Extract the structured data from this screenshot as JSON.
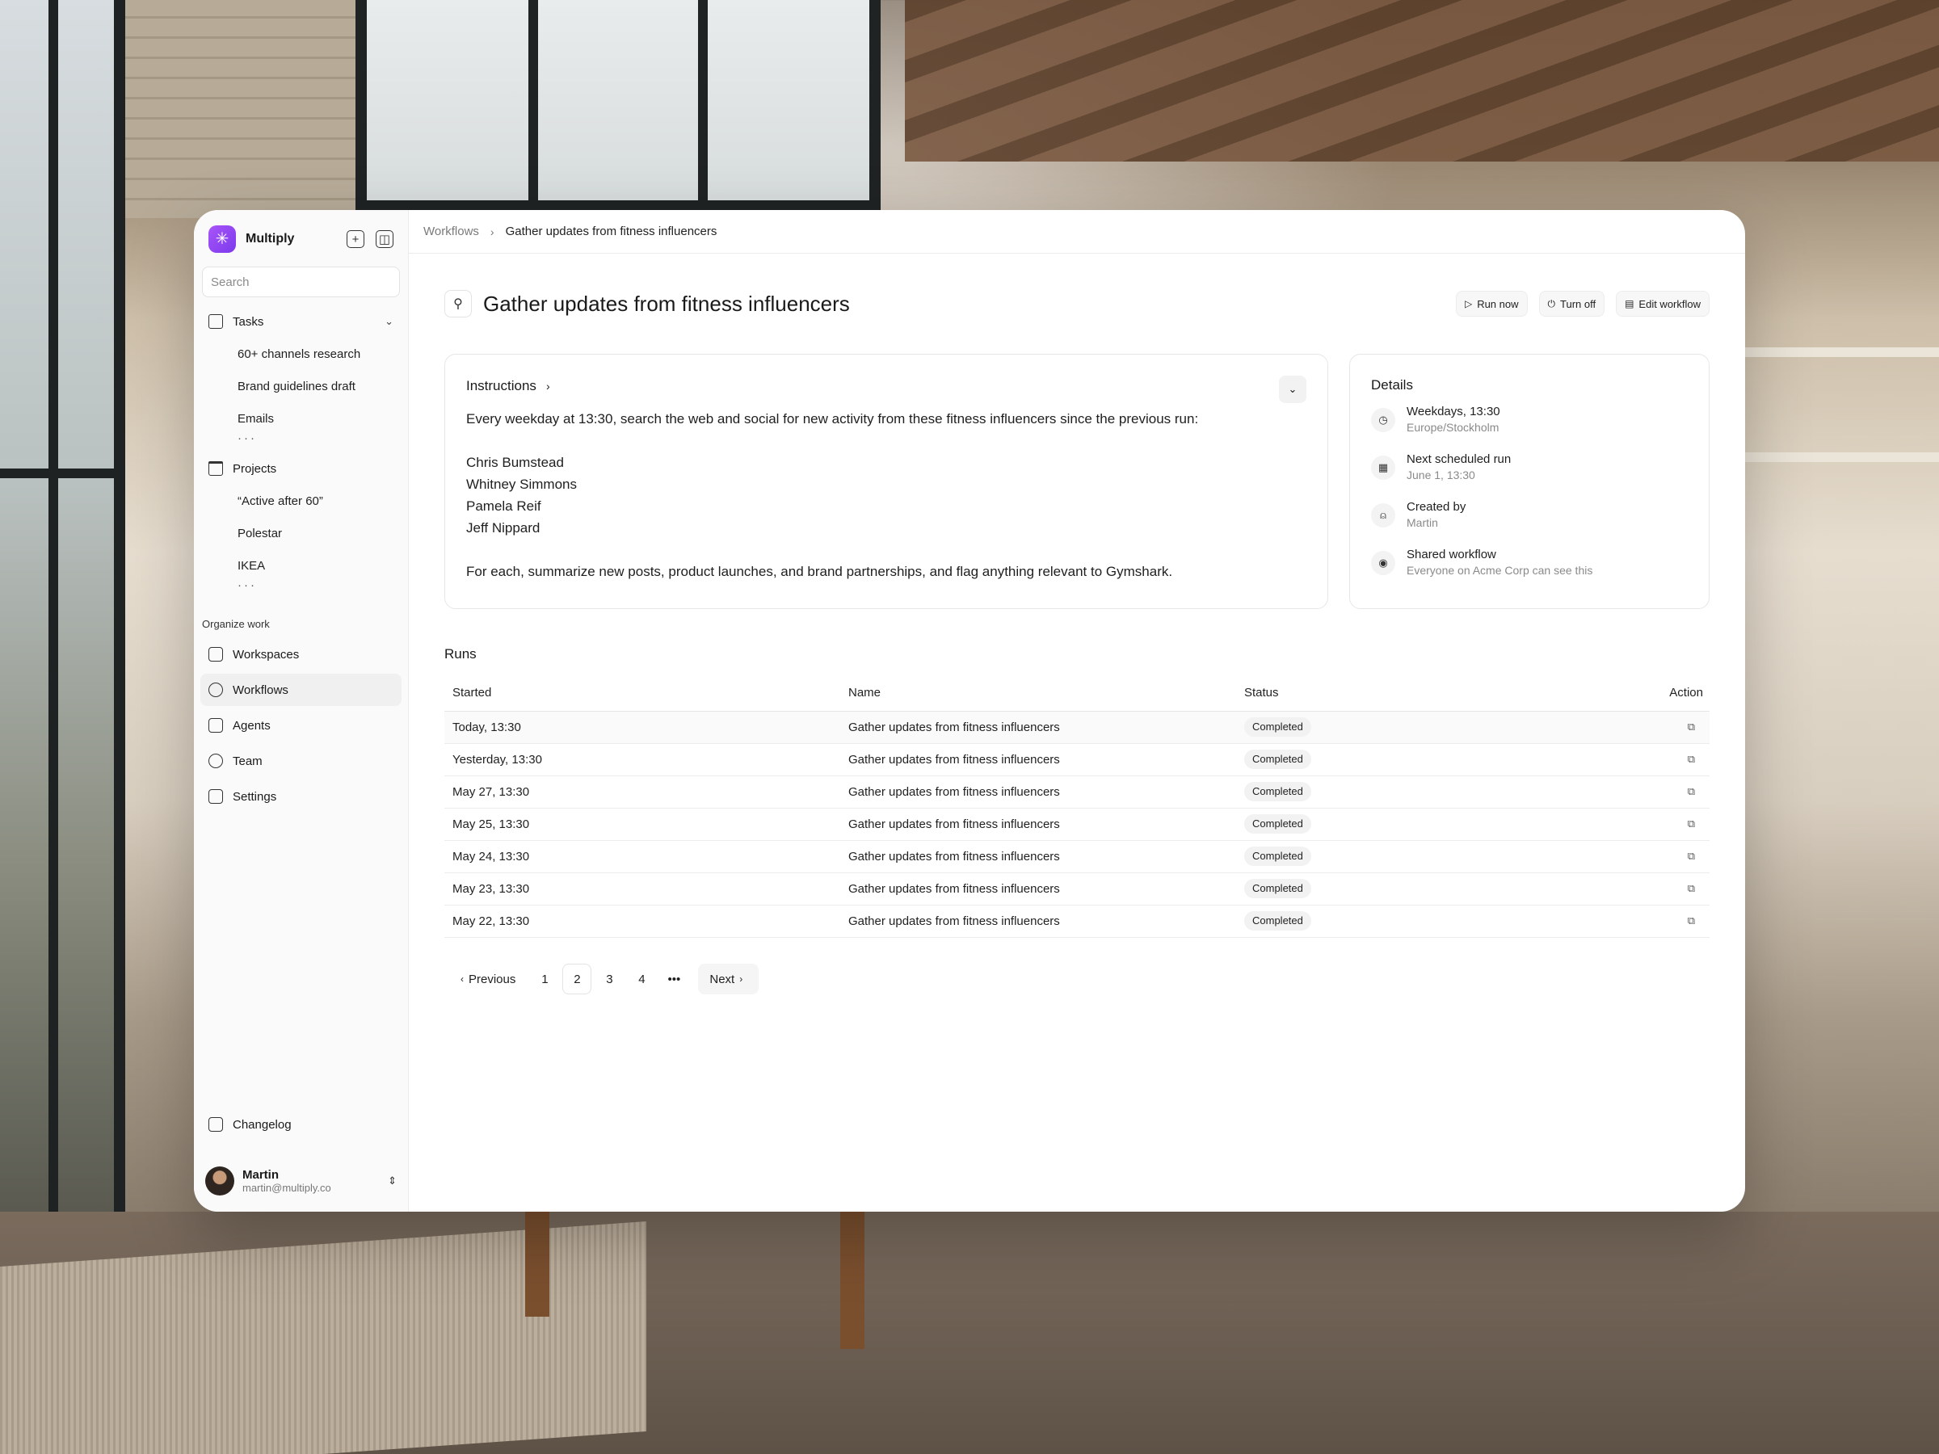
{
  "app": {
    "name": "Multiply"
  },
  "sidebar": {
    "search_placeholder": "Search",
    "tasks": {
      "label": "Tasks",
      "items": [
        "60+ channels research",
        "Brand guidelines draft",
        "Emails"
      ],
      "more": "···"
    },
    "projects": {
      "label": "Projects",
      "items": [
        "“Active after 60”",
        "Polestar",
        "IKEA"
      ],
      "more": "···"
    },
    "organize_label": "Organize work",
    "nav": [
      {
        "label": "Workspaces",
        "icon": "workspaces-icon"
      },
      {
        "label": "Workflows",
        "icon": "workflow-icon",
        "active": true
      },
      {
        "label": "Agents",
        "icon": "robot-icon"
      },
      {
        "label": "Team",
        "icon": "team-icon"
      },
      {
        "label": "Settings",
        "icon": "settings-icon"
      }
    ],
    "changelog": "Changelog",
    "user": {
      "name": "Martin",
      "email": "martin@multiply.co"
    }
  },
  "breadcrumb": {
    "root": "Workflows",
    "current": "Gather updates from fitness influencers"
  },
  "page": {
    "title": "Gather updates from fitness influencers",
    "actions": {
      "run_now": "Run now",
      "turn_off": "Turn off",
      "edit": "Edit workflow"
    }
  },
  "instructions": {
    "title": "Instructions",
    "intro": "Every weekday at 13:30, search the web and social for new activity from these fitness influencers since the previous run:",
    "influencers": [
      "Chris Bumstead",
      "Whitney Simmons",
      "Pamela Reif",
      "Jeff Nippard"
    ],
    "outro": "For each, summarize new posts, product launches, and brand partnerships, and flag anything relevant to Gymshark."
  },
  "details": {
    "title": "Details",
    "rows": [
      {
        "icon": "clock-icon",
        "main": "Weekdays, 13:30",
        "sub": "Europe/Stockholm"
      },
      {
        "icon": "calendar-icon",
        "main": "Next scheduled run",
        "sub": "June 1, 13:30"
      },
      {
        "icon": "user-icon",
        "main": "Created by",
        "sub": "Martin"
      },
      {
        "icon": "eye-icon",
        "main": "Shared workflow",
        "sub": "Everyone on Acme Corp can see this"
      }
    ]
  },
  "runs": {
    "title": "Runs",
    "columns": {
      "started": "Started",
      "name": "Name",
      "status": "Status",
      "action": "Action"
    },
    "rows": [
      {
        "started": "Today, 13:30",
        "name": "Gather updates from fitness influencers",
        "status": "Completed"
      },
      {
        "started": "Yesterday, 13:30",
        "name": "Gather updates from fitness influencers",
        "status": "Completed"
      },
      {
        "started": "May 27, 13:30",
        "name": "Gather updates from fitness influencers",
        "status": "Completed"
      },
      {
        "started": "May 25, 13:30",
        "name": "Gather updates from fitness influencers",
        "status": "Completed"
      },
      {
        "started": "May 24, 13:30",
        "name": "Gather updates from fitness influencers",
        "status": "Completed"
      },
      {
        "started": "May 23, 13:30",
        "name": "Gather updates from fitness influencers",
        "status": "Completed"
      },
      {
        "started": "May 22, 13:30",
        "name": "Gather updates from fitness influencers",
        "status": "Completed"
      }
    ]
  },
  "pagination": {
    "previous": "Previous",
    "next": "Next",
    "pages": [
      "1",
      "2",
      "3",
      "4"
    ],
    "current": "2",
    "ellipsis": "•••"
  },
  "colors": {
    "brand": "#8b5cf6",
    "surface": "#ffffff",
    "sidebar": "#fafafa"
  }
}
